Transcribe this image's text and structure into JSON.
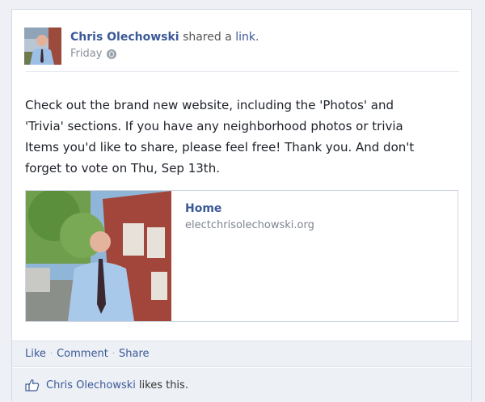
{
  "post": {
    "author": "Chris Olechowski",
    "action_text": "shared a",
    "action_link": "link.",
    "time": "Friday",
    "privacy_icon": "globe-icon",
    "message_lines": [
      "Check out the brand new website, including the 'Photos' and",
      "'Trivia' sections. If you have any neighborhood photos or trivia",
      "Items you'd like to share, please feel free! Thank you. And don't",
      "forget to vote on Thu, Sep 13th."
    ]
  },
  "attachment": {
    "title": "Home",
    "url": "electchrisolechowski.org"
  },
  "actions": {
    "like": "Like",
    "comment": "Comment",
    "share": "Share",
    "separator": "·"
  },
  "likes": {
    "icon": "thumbs-up-icon",
    "name": "Chris Olechowski",
    "text": "likes this."
  }
}
